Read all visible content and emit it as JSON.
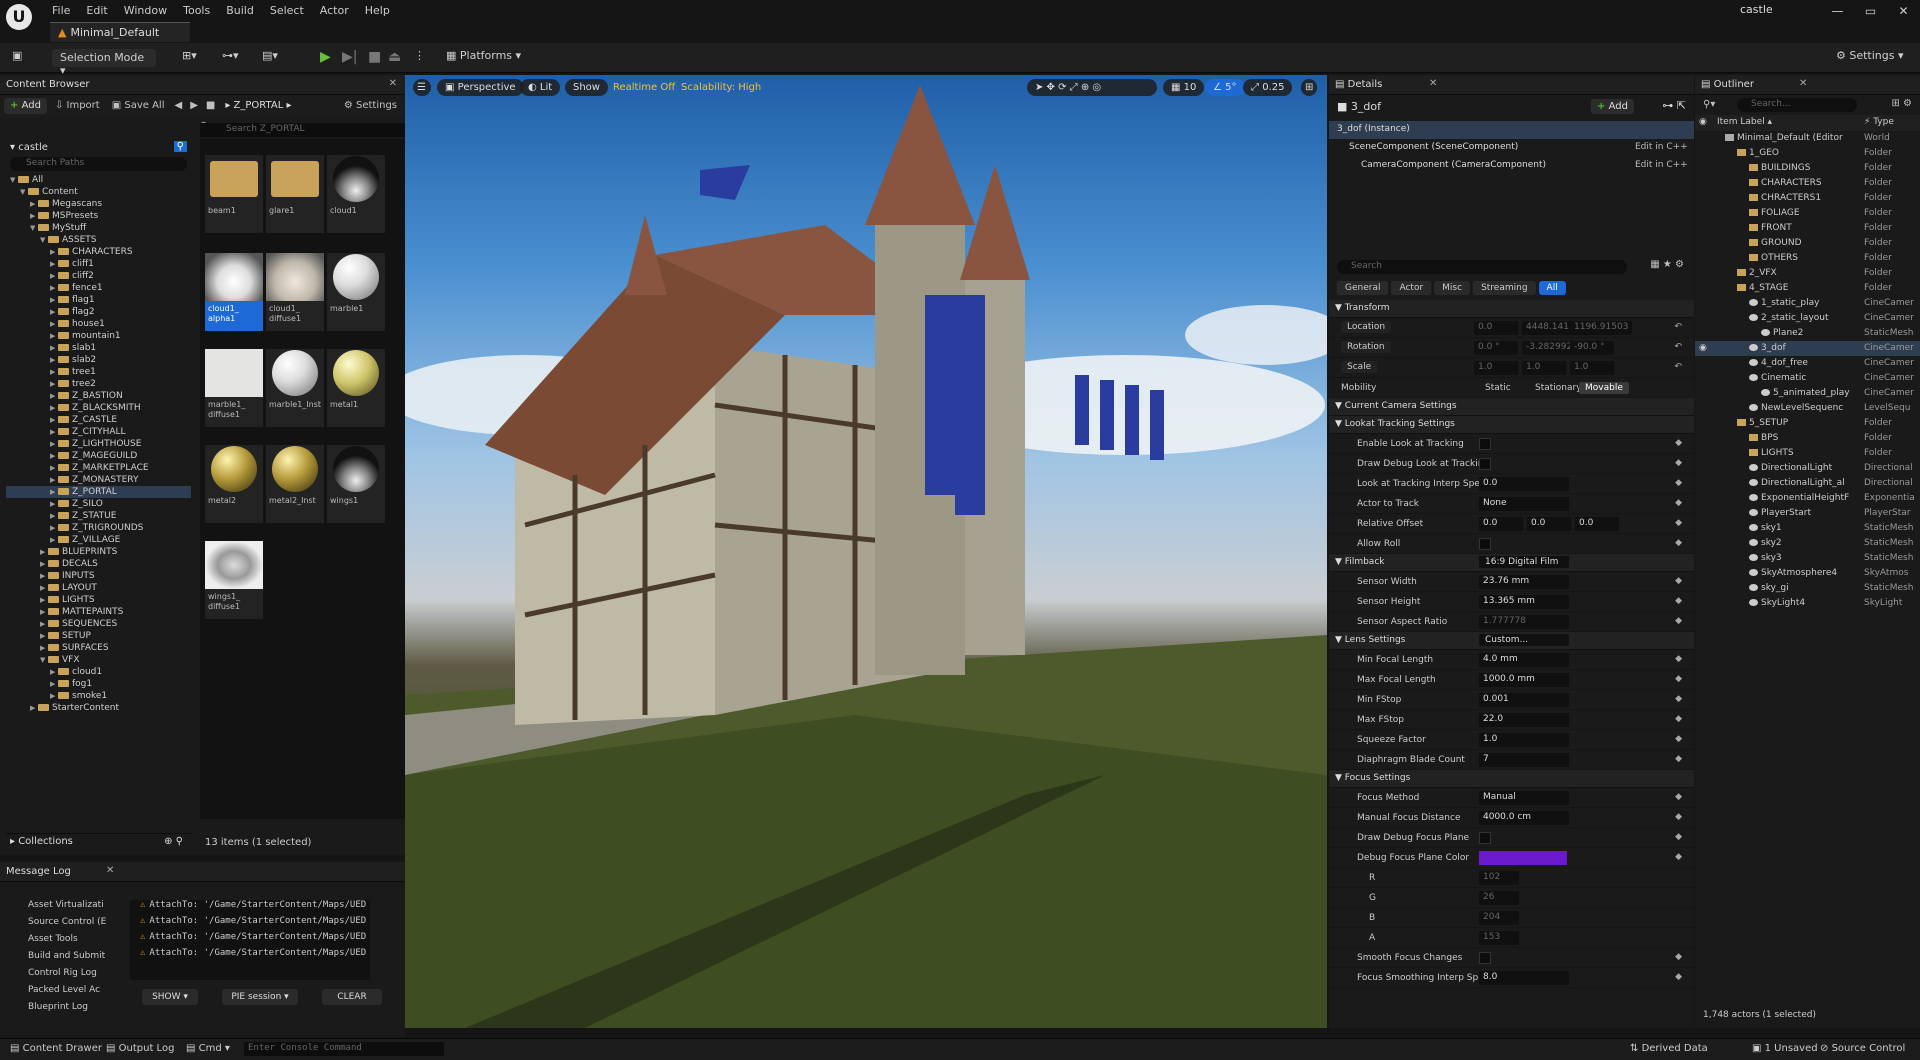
{
  "app": {
    "logo": "U",
    "project": "castle",
    "level_tab": "Minimal_Default",
    "menu": [
      "File",
      "Edit",
      "Window",
      "Tools",
      "Build",
      "Select",
      "Actor",
      "Help"
    ],
    "win": [
      "—",
      "▭",
      "✕"
    ]
  },
  "toolbar": {
    "selection_mode": "Selection Mode",
    "platforms": "Platforms",
    "settings": "Settings"
  },
  "content_browser": {
    "tab": "Content Browser",
    "add": "Add",
    "import": "Import",
    "save_all": "Save All",
    "settings": "Settings",
    "breadcrumb": "Z_PORTAL",
    "tree_root": "castle",
    "search_paths": "Search Paths",
    "search_assets": "Search Z_PORTAL",
    "tree": [
      {
        "n": "All",
        "d": 0,
        "o": true
      },
      {
        "n": "Content",
        "d": 1,
        "o": true
      },
      {
        "n": "Megascans",
        "d": 2
      },
      {
        "n": "MSPresets",
        "d": 2
      },
      {
        "n": "MyStuff",
        "d": 2,
        "o": true
      },
      {
        "n": "ASSETS",
        "d": 3,
        "o": true
      },
      {
        "n": "CHARACTERS",
        "d": 4
      },
      {
        "n": "cliff1",
        "d": 4
      },
      {
        "n": "cliff2",
        "d": 4
      },
      {
        "n": "fence1",
        "d": 4
      },
      {
        "n": "flag1",
        "d": 4
      },
      {
        "n": "flag2",
        "d": 4
      },
      {
        "n": "house1",
        "d": 4
      },
      {
        "n": "mountain1",
        "d": 4
      },
      {
        "n": "slab1",
        "d": 4
      },
      {
        "n": "slab2",
        "d": 4
      },
      {
        "n": "tree1",
        "d": 4
      },
      {
        "n": "tree2",
        "d": 4
      },
      {
        "n": "Z_BASTION",
        "d": 4
      },
      {
        "n": "Z_BLACKSMITH",
        "d": 4
      },
      {
        "n": "Z_CASTLE",
        "d": 4
      },
      {
        "n": "Z_CITYHALL",
        "d": 4
      },
      {
        "n": "Z_LIGHTHOUSE",
        "d": 4
      },
      {
        "n": "Z_MAGEGUILD",
        "d": 4
      },
      {
        "n": "Z_MARKETPLACE",
        "d": 4
      },
      {
        "n": "Z_MONASTERY",
        "d": 4
      },
      {
        "n": "Z_PORTAL",
        "d": 4,
        "s": true
      },
      {
        "n": "Z_SILO",
        "d": 4
      },
      {
        "n": "Z_STATUE",
        "d": 4
      },
      {
        "n": "Z_TRIGROUNDS",
        "d": 4
      },
      {
        "n": "Z_VILLAGE",
        "d": 4
      },
      {
        "n": "BLUEPRINTS",
        "d": 3
      },
      {
        "n": "DECALS",
        "d": 3
      },
      {
        "n": "INPUTS",
        "d": 3
      },
      {
        "n": "LAYOUT",
        "d": 3
      },
      {
        "n": "LIGHTS",
        "d": 3
      },
      {
        "n": "MATTEPAINTS",
        "d": 3
      },
      {
        "n": "SEQUENCES",
        "d": 3
      },
      {
        "n": "SETUP",
        "d": 3
      },
      {
        "n": "SURFACES",
        "d": 3
      },
      {
        "n": "VFX",
        "d": 3,
        "o": true
      },
      {
        "n": "cloud1",
        "d": 4
      },
      {
        "n": "fog1",
        "d": 4
      },
      {
        "n": "smoke1",
        "d": 4
      },
      {
        "n": "StarterContent",
        "d": 2
      }
    ],
    "collections": "Collections",
    "assets": [
      {
        "l": "beam1",
        "k": "folder"
      },
      {
        "l": "glare1",
        "k": "folder"
      },
      {
        "l": "cloud1",
        "k": "moon"
      },
      {
        "l": "cloud1_\nalpha1",
        "k": "cloud",
        "s": true
      },
      {
        "l": "cloud1_\ndiffuse1",
        "k": "cloud2"
      },
      {
        "l": "marble1",
        "k": "white"
      },
      {
        "l": "marble1_\ndiffuse1",
        "k": "flat"
      },
      {
        "l": "marble1_Inst",
        "k": "white"
      },
      {
        "l": "metal1",
        "k": "yellow"
      },
      {
        "l": "metal2",
        "k": "gold"
      },
      {
        "l": "metal2_Inst",
        "k": "gold"
      },
      {
        "l": "wings1",
        "k": "moon"
      },
      {
        "l": "wings1_\ndiffuse1",
        "k": "wing"
      }
    ],
    "count": "13 items (1 selected)"
  },
  "message_log": {
    "tab": "Message Log",
    "categories": [
      "Asset Virtualizati",
      "Source Control (E",
      "Asset Tools",
      "Build and Submit",
      "Control Rig Log",
      "Packed Level Ac",
      "Blueprint Log"
    ],
    "messages": [
      "AttachTo: '/Game/StarterContent/Maps/UED",
      "AttachTo: '/Game/StarterContent/Maps/UED",
      "AttachTo: '/Game/StarterContent/Maps/UED",
      "AttachTo: '/Game/StarterContent/Maps/UED"
    ],
    "show": "SHOW",
    "pie": "PIE session",
    "clear": "CLEAR"
  },
  "viewport": {
    "perspective": "Perspective",
    "lit": "Lit",
    "show": "Show",
    "realtime": "Realtime Off",
    "scalability": "Scalability: High",
    "grid": "10",
    "angle": "5°",
    "camspeed": "0.25"
  },
  "details": {
    "tab": "Details",
    "actor": "3_dof",
    "add": "Add",
    "components": [
      {
        "n": "3_dof (Instance)",
        "e": ""
      },
      {
        "n": "SceneComponent (SceneComponent)",
        "e": "Edit in C++"
      },
      {
        "n": "CameraComponent (CameraComponent)",
        "e": "Edit in C++"
      }
    ],
    "search": "Search",
    "filters": [
      "General",
      "Actor",
      "Misc",
      "Streaming",
      "All"
    ],
    "transform": "Transform",
    "location": [
      "Location",
      "0.0",
      "4448.14111",
      "1196.91503"
    ],
    "rotation": [
      "Rotation",
      "0.0 °",
      "-3.282992 °",
      "-90.0 °"
    ],
    "scale": [
      "Scale",
      "1.0",
      "1.0",
      "1.0"
    ],
    "mobility": "Mobility",
    "mob_opts": [
      "Static",
      "Stationary",
      "Movable"
    ],
    "sec_camera": "Current Camera Settings",
    "sec_lookat": "Lookat Tracking Settings",
    "rows": [
      {
        "k": "Enable Look at Tracking",
        "t": "chk"
      },
      {
        "k": "Draw Debug Look at Trackin...",
        "t": "chk"
      },
      {
        "k": "Look at Tracking Interp Spe...",
        "v": "0.0"
      },
      {
        "k": "Actor to Track",
        "v": "None"
      },
      {
        "k": "Relative Offset",
        "v": "0.0",
        "v2": "0.0",
        "v3": "0.0"
      },
      {
        "k": "Allow Roll",
        "t": "chk"
      }
    ],
    "filmback": "Filmback",
    "filmback_v": "16:9 Digital Film",
    "film_rows": [
      {
        "k": "Sensor Width",
        "v": "23.76 mm"
      },
      {
        "k": "Sensor Height",
        "v": "13.365 mm"
      },
      {
        "k": "Sensor Aspect Ratio",
        "v": "1.777778",
        "dim": true
      }
    ],
    "lens": "Lens Settings",
    "lens_v": "Custom...",
    "lens_rows": [
      {
        "k": "Min Focal Length",
        "v": "4.0 mm"
      },
      {
        "k": "Max Focal Length",
        "v": "1000.0 mm"
      },
      {
        "k": "Min FStop",
        "v": "0.001"
      },
      {
        "k": "Max FStop",
        "v": "22.0"
      },
      {
        "k": "Squeeze Factor",
        "v": "1.0"
      },
      {
        "k": "Diaphragm Blade Count",
        "v": "7"
      }
    ],
    "focus": "Focus Settings",
    "focus_rows": [
      {
        "k": "Focus Method",
        "v": "Manual"
      },
      {
        "k": "Manual Focus Distance",
        "v": "4000.0 cm"
      },
      {
        "k": "Draw Debug Focus Plane",
        "t": "chk"
      },
      {
        "k": "Debug Focus Plane Color",
        "t": "color"
      }
    ],
    "rgba": [
      [
        "R",
        "102"
      ],
      [
        "G",
        "26"
      ],
      [
        "B",
        "204"
      ],
      [
        "A",
        "153"
      ]
    ],
    "tail_rows": [
      {
        "k": "Smooth Focus Changes",
        "t": "chk"
      },
      {
        "k": "Focus Smoothing Interp Sp...",
        "v": "8.0"
      }
    ],
    "color_hex": "#6a1acc"
  },
  "outliner": {
    "tab": "Outliner",
    "search": "Search...",
    "col_label": "Item Label",
    "col_type": "Type",
    "rows": [
      {
        "n": "Minimal_Default (Editor",
        "t": "World",
        "d": 0
      },
      {
        "n": "1_GEO",
        "t": "Folder",
        "d": 1
      },
      {
        "n": "BUILDINGS",
        "t": "Folder",
        "d": 2
      },
      {
        "n": "CHARACTERS",
        "t": "Folder",
        "d": 2
      },
      {
        "n": "CHRACTERS1",
        "t": "Folder",
        "d": 2
      },
      {
        "n": "FOLIAGE",
        "t": "Folder",
        "d": 2
      },
      {
        "n": "FRONT",
        "t": "Folder",
        "d": 2
      },
      {
        "n": "GROUND",
        "t": "Folder",
        "d": 2
      },
      {
        "n": "OTHERS",
        "t": "Folder",
        "d": 2
      },
      {
        "n": "2_VFX",
        "t": "Folder",
        "d": 1
      },
      {
        "n": "4_STAGE",
        "t": "Folder",
        "d": 1
      },
      {
        "n": "1_static_play",
        "t": "CineCamer",
        "d": 2
      },
      {
        "n": "2_static_layout",
        "t": "CineCamer",
        "d": 2
      },
      {
        "n": "Plane2",
        "t": "StaticMesh",
        "d": 3
      },
      {
        "n": "3_dof",
        "t": "CineCamer",
        "d": 2,
        "s": true
      },
      {
        "n": "4_dof_free",
        "t": "CineCamer",
        "d": 2
      },
      {
        "n": "Cinematic",
        "t": "CineCamer",
        "d": 2
      },
      {
        "n": "5_animated_play",
        "t": "CineCamer",
        "d": 3
      },
      {
        "n": "NewLevelSequenc",
        "t": "LevelSequ",
        "d": 2
      },
      {
        "n": "5_SETUP",
        "t": "Folder",
        "d": 1
      },
      {
        "n": "BPS",
        "t": "Folder",
        "d": 2
      },
      {
        "n": "LIGHTS",
        "t": "Folder",
        "d": 2
      },
      {
        "n": "DirectionalLight",
        "t": "Directional",
        "d": 2
      },
      {
        "n": "DirectionalLight_al",
        "t": "Directional",
        "d": 2
      },
      {
        "n": "ExponentialHeightF",
        "t": "Exponentia",
        "d": 2
      },
      {
        "n": "PlayerStart",
        "t": "PlayerStar",
        "d": 2
      },
      {
        "n": "sky1",
        "t": "StaticMesh",
        "d": 2
      },
      {
        "n": "sky2",
        "t": "StaticMesh",
        "d": 2
      },
      {
        "n": "sky3",
        "t": "StaticMesh",
        "d": 2
      },
      {
        "n": "SkyAtmosphere4",
        "t": "SkyAtmos",
        "d": 2
      },
      {
        "n": "sky_gi",
        "t": "StaticMesh",
        "d": 2
      },
      {
        "n": "SkyLight4",
        "t": "SkyLight",
        "d": 2
      }
    ],
    "count": "1,748 actors (1 selected)"
  },
  "status": {
    "drawer": "Content Drawer",
    "output": "Output Log",
    "cmd": "Cmd",
    "console": "Enter Console Command",
    "derived": "Derived Data",
    "unsaved": "1 Unsaved",
    "source": "Source Control"
  }
}
